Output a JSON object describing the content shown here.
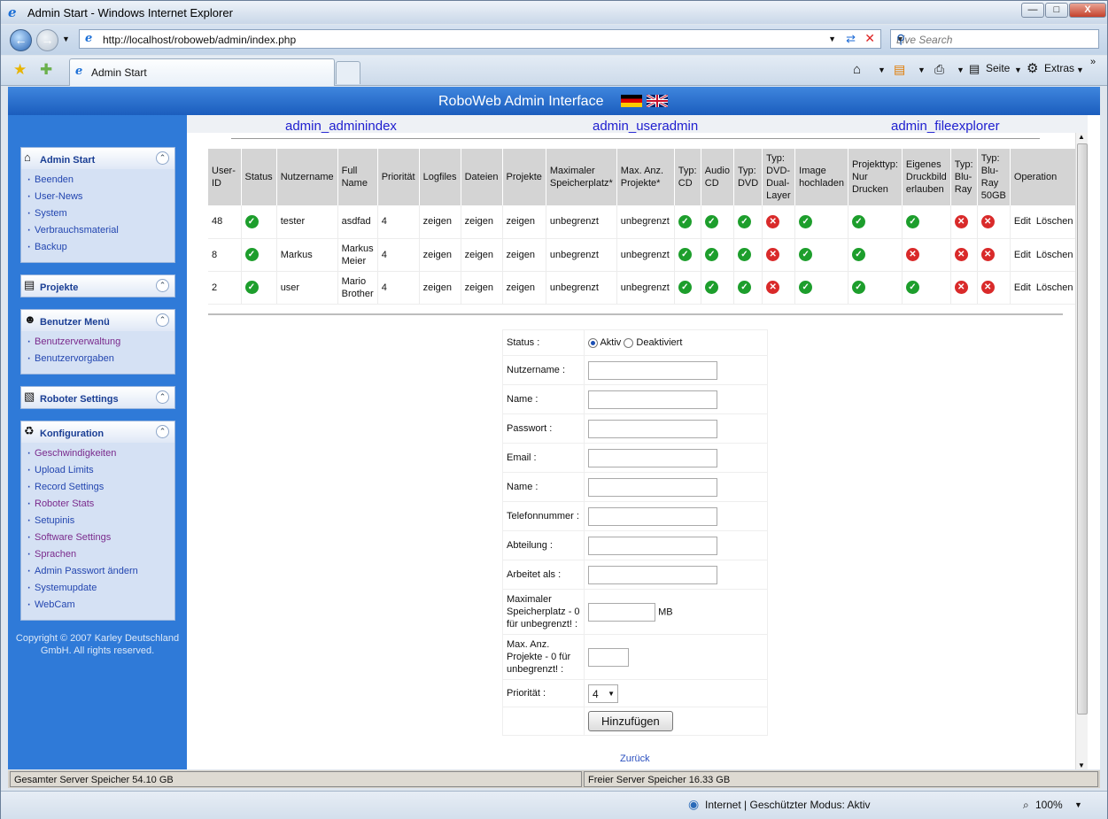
{
  "window": {
    "title": "Admin Start - Windows Internet Explorer",
    "minimize": "—",
    "maximize": "□",
    "close": "X"
  },
  "nav": {
    "url": "http://localhost/roboweb/admin/index.php",
    "search_placeholder": "Live Search"
  },
  "tabs": {
    "active": "Admin Start"
  },
  "toolbar": {
    "seite": "Seite",
    "extras": "Extras"
  },
  "banner": {
    "title": "RoboWeb Admin Interface"
  },
  "sidebar": {
    "admin_start": {
      "title": "Admin Start",
      "items": [
        "Beenden",
        "User-News",
        "System",
        "Verbrauchsmaterial",
        "Backup"
      ]
    },
    "projekte": {
      "title": "Projekte"
    },
    "benutzer": {
      "title": "Benutzer Menü",
      "items": [
        "Benutzerverwaltung",
        "Benutzervorgaben"
      ]
    },
    "roboter": {
      "title": "Roboter Settings"
    },
    "konfig": {
      "title": "Konfiguration",
      "items": [
        "Geschwindigkeiten",
        "Upload Limits",
        "Record Settings",
        "Roboter Stats",
        "Setupinis",
        "Software Settings",
        "Sprachen",
        "Admin Passwort ändern",
        "Systemupdate",
        "WebCam"
      ]
    },
    "copyright": "Copyright © 2007 Karley Deutschland GmbH. All rights reserved."
  },
  "toptabs": [
    "admin_adminindex",
    "admin_useradmin",
    "admin_fileexplorer"
  ],
  "table": {
    "headers": [
      "User-ID",
      "Status",
      "Nutzername",
      "Full Name",
      "Priorität",
      "Logfiles",
      "Dateien",
      "Projekte",
      "Maximaler Speicherplatz*",
      "Max. Anz. Projekte*",
      "Typ: CD",
      "Audio CD",
      "Typ: DVD",
      "Typ: DVD-Dual-Layer",
      "Image hochladen",
      "Projekttyp: Nur Drucken",
      "Eigenes Druckbild erlauben",
      "Typ: Blu-Ray",
      "Typ: Blu-Ray 50GB",
      "Operation"
    ],
    "rows": [
      {
        "id": "48",
        "user": "tester",
        "full": "asdfad",
        "prio": "4",
        "log": "zeigen",
        "dat": "zeigen",
        "proj": "zeigen",
        "space": "unbegrenzt",
        "maxproj": "unbegrenzt",
        "flags": [
          true,
          true,
          true,
          false,
          true,
          true,
          true,
          false,
          false
        ],
        "edit": "Edit",
        "del": "Löschen"
      },
      {
        "id": "8",
        "user": "Markus",
        "full": "Markus Meier",
        "prio": "4",
        "log": "zeigen",
        "dat": "zeigen",
        "proj": "zeigen",
        "space": "unbegrenzt",
        "maxproj": "unbegrenzt",
        "flags": [
          true,
          true,
          true,
          false,
          true,
          true,
          false,
          false,
          false
        ],
        "edit": "Edit",
        "del": "Löschen"
      },
      {
        "id": "2",
        "user": "user",
        "full": "Mario Brother",
        "prio": "4",
        "log": "zeigen",
        "dat": "zeigen",
        "proj": "zeigen",
        "space": "unbegrenzt",
        "maxproj": "unbegrenzt",
        "flags": [
          true,
          true,
          true,
          false,
          true,
          true,
          true,
          false,
          false
        ],
        "edit": "Edit",
        "del": "Löschen"
      }
    ]
  },
  "form": {
    "status_label": "Status :",
    "aktiv": "Aktiv",
    "deaktiviert": "Deaktiviert",
    "fields": [
      "Nutzername :",
      "Name :",
      "Passwort :",
      "Email :",
      "Name :",
      "Telefonnummer :",
      "Abteilung :",
      "Arbeitet als :"
    ],
    "speicher_label": "Maximaler Speicherplatz - 0 für unbegrenzt! :",
    "mb": "MB",
    "maxproj_label": "Max. Anz. Projekte - 0 für unbegrenzt! :",
    "prio_label": "Priorität :",
    "prio_value": "4",
    "submit": "Hinzufügen"
  },
  "zurueck": "Zurück",
  "server": {
    "total": "Gesamter Server Speicher 54.10 GB",
    "free": "Freier Server Speicher 16.33 GB"
  },
  "status": {
    "zone": "Internet | Geschützter Modus: Aktiv",
    "zoom": "100%"
  }
}
